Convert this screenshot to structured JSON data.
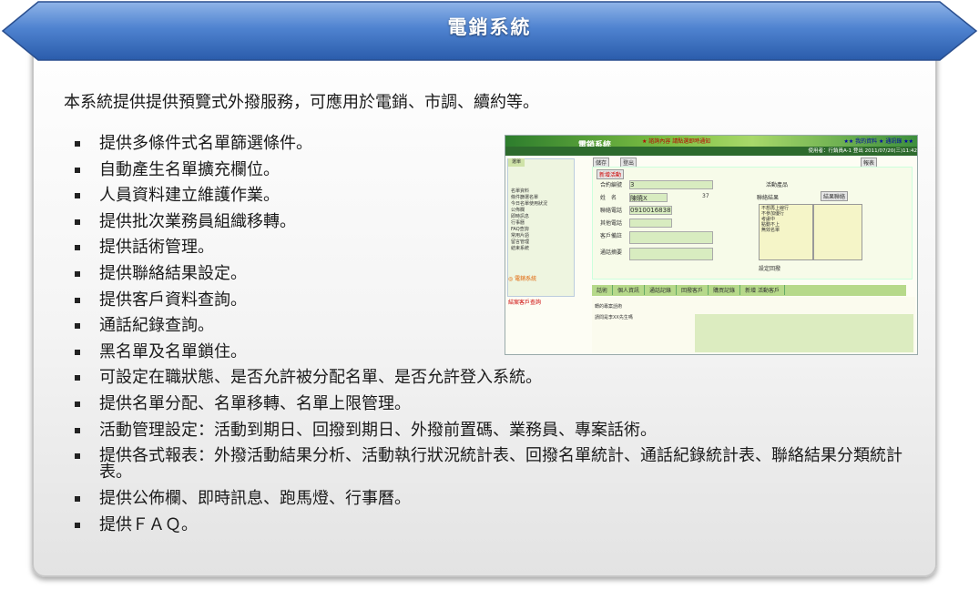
{
  "banner": {
    "title": "電銷系統"
  },
  "intro": "本系統提供提供預覽式外撥服務，可應用於電銷、市調、續約等。",
  "features": [
    "提供多條件式名單篩選條件。",
    "自動產生名單擴充欄位。",
    "人員資料建立維護作業。",
    "提供批次業務員組織移轉。",
    "提供話術管理。",
    "提供聯絡結果設定。",
    "提供客戶資料查詢。",
    "通話紀錄查詢。",
    "黑名單及名單鎖住。",
    "可設定在職狀態、是否允許被分配名單、是否允許登入系統。",
    "提供名單分配、名單移轉、名單上限管理。",
    "活動管理設定：活動到期日、回撥到期日、外撥前置碼、業務員、專案話術。",
    "提供各式報表：外撥活動結果分析、活動執行狀況統計表、回撥名單統計、通話紀錄統計表、聯絡結果分類統計表。",
    "提供公佈欄、即時訊息、跑馬燈、行事曆。",
    "提供ＦＡＱ。"
  ],
  "screenshot": {
    "logo": "電銷系統",
    "notice": "★ 諮詢內容 請點選即時通知",
    "links": "★★ 我的資料 ★ 通訊錄 ★★",
    "subheader": "使用者：行銷員A-1  登出 2011/07/20(三)11:42",
    "side_label": "選單",
    "menu": [
      "名單資料",
      "條件篩選名單",
      "今日名單使用狀況",
      "公佈欄",
      "即時訊息",
      "行事曆",
      "FAQ查詢",
      "常用片語",
      "留言管理",
      "結束系統"
    ],
    "orange_logo": "◎ 電銷系統",
    "red_text": "結案客戶查詢",
    "buttons": {
      "save": "儲存",
      "logout": "登出",
      "new_activity": "新增活動",
      "report": "報表",
      "result": "結果聯絡"
    },
    "fields": [
      {
        "label": "合約編號",
        "value": "3"
      },
      {
        "label": "姓　名",
        "value": "陳曉X"
      },
      {
        "label": "聯絡電話",
        "value": "0910016838"
      },
      {
        "label": "其他電話",
        "value": ""
      },
      {
        "label": "客戶備註",
        "value": ""
      },
      {
        "label": "通話摘要",
        "value": ""
      }
    ],
    "activity_product_label": "活動產品",
    "contact_result_label": "聯絡結果",
    "age_value": "37",
    "results": [
      "不想再上線行",
      "不參加優行",
      "考慮中",
      "點動不上",
      "無效名單"
    ],
    "reset_label": "設定回撥",
    "tabs": [
      "話術",
      "個人資訊",
      "通話記錄",
      "回撥客戶",
      "購買記錄",
      "新增 活動客戶"
    ],
    "lower_items": [
      "轉的專案話術",
      "請問是李XX先生嗎"
    ]
  }
}
